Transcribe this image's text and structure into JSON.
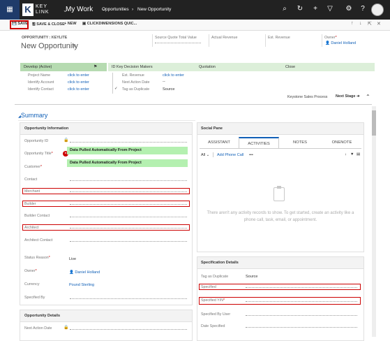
{
  "nav": {
    "logo_text": "KEY LINK",
    "app": "My Work",
    "breadcrumb": [
      "Opportunities",
      "New Opportunity"
    ]
  },
  "toolbar": {
    "save": "SAVE",
    "save_close": "SAVE & CLOSE",
    "new": "NEW",
    "clickdimensions": "CLICKDIMENSIONS QUIC..."
  },
  "header": {
    "entity": "OPPORTUNITY : KEYLITE",
    "title": "New Opportunity",
    "source_quote_label": "Source Quote Total Value",
    "actual_revenue_label": "Actual Revenue",
    "est_revenue_label": "Est. Revenue",
    "owner_label": "Owner",
    "owner_value": "Daniel Holland"
  },
  "process": {
    "stages": [
      "Develop (Active)",
      "ID Key Decision Makers",
      "Quotation",
      "Close"
    ],
    "fields_left": [
      {
        "label": "Project Name",
        "value": "click to enter"
      },
      {
        "label": "Identify Account",
        "value": "click to enter"
      },
      {
        "label": "Identify Contact",
        "value": "click to enter"
      }
    ],
    "fields_right": [
      {
        "label": "Est. Revenue",
        "value": "click to enter"
      },
      {
        "label": "Next Action Date",
        "value": "--"
      },
      {
        "label": "Tag as Duplicate",
        "value": "Source"
      }
    ],
    "process_name": "Keystone Sales Process",
    "next_stage": "Next Stage"
  },
  "summary": "Summary",
  "opportunity_info": {
    "title": "Opportunity Information",
    "fields": [
      {
        "label": "Opportunity ID",
        "value": ""
      },
      {
        "label": "Opportunity Title",
        "value": "Data Pulled Automatically From Project"
      },
      {
        "label": "Customer",
        "value": "Data Pulled Automatically From Project"
      },
      {
        "label": "Contact",
        "value": ""
      },
      {
        "label": "Merchant",
        "value": ""
      },
      {
        "label": "Builder",
        "value": ""
      },
      {
        "label": "Builder Contact",
        "value": ""
      },
      {
        "label": "Architect",
        "value": ""
      },
      {
        "label": "Architect Contact",
        "value": ""
      },
      {
        "label": "Status Reason",
        "value": "Live"
      },
      {
        "label": "Owner",
        "value": "Daniel Holland"
      },
      {
        "label": "Currency",
        "value": "Pound Sterling"
      },
      {
        "label": "Specified By",
        "value": ""
      }
    ]
  },
  "opportunity_details": {
    "title": "Opportunity Details",
    "fields": [
      {
        "label": "Next Action Date",
        "value": ""
      }
    ]
  },
  "social": {
    "title": "Social Pane",
    "tabs": [
      "ASSISTANT",
      "ACTIVITIES",
      "NOTES",
      "ONENOTE"
    ],
    "filter": "All",
    "add_phone": "Add Phone Call",
    "more": "•••",
    "empty": "There aren't any activity records to show. To get started, create an activity like a phone call, task, email, or appointment."
  },
  "spec": {
    "title": "Specification Details",
    "fields": [
      {
        "label": "Tag as Duplicate",
        "value": "Source"
      },
      {
        "label": "Specified",
        "value": ""
      },
      {
        "label": "Specified Y/N",
        "value": ""
      },
      {
        "label": "Specified By User",
        "value": ""
      },
      {
        "label": "Date Specified",
        "value": ""
      }
    ]
  },
  "colors": {
    "nav": "#222222",
    "accent": "#1160b7",
    "stage_active": "#b6dbb1",
    "highlight": "#b4f0b0",
    "error": "#cc0000"
  }
}
